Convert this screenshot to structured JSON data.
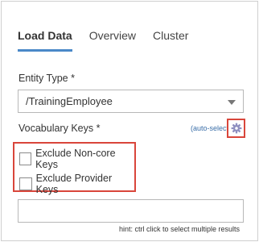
{
  "tabs": [
    {
      "label": "Load Data",
      "active": true
    },
    {
      "label": "Overview",
      "active": false
    },
    {
      "label": "Cluster",
      "active": false
    }
  ],
  "entity_type": {
    "label": "Entity Type",
    "required_mark": "*",
    "value": "/TrainingEmployee"
  },
  "vocabulary_keys": {
    "label": "Vocabulary Keys",
    "required_mark": "*",
    "auto_select_label": "(auto-select)",
    "settings_icon": "gear-icon"
  },
  "options": [
    {
      "label": "Exclude Non-core Keys",
      "checked": false
    },
    {
      "label": "Exclude Provider Keys",
      "checked": false
    }
  ],
  "hint": "hint: ctrl click to select multiple results",
  "colors": {
    "accent": "#4a89c8",
    "highlight": "#d9463b",
    "link": "#3a6ea8"
  }
}
